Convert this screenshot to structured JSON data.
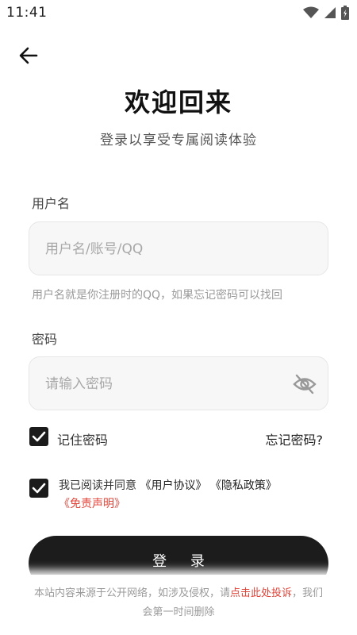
{
  "status_bar": {
    "time": "11:41"
  },
  "header": {
    "title": "欢迎回来",
    "subtitle": "登录以享受专属阅读体验"
  },
  "username": {
    "label": "用户名",
    "placeholder": "用户名/账号/QQ",
    "value": "",
    "hint": "用户名就是你注册时的QQ，如果忘记密码可以找回"
  },
  "password": {
    "label": "密码",
    "placeholder": "请输入密码",
    "value": ""
  },
  "remember": {
    "label": "记住密码",
    "checked": true
  },
  "forgot_link": "忘记密码?",
  "agreement": {
    "checked": true,
    "prefix": "我已阅读并同意 ",
    "user_agreement": "《用户协议》",
    "privacy_policy": " 《隐私政策》",
    "disclaimer": "《免责声明》"
  },
  "login_button": "登 录",
  "footer": {
    "text_before": "本站内容来源于公开网络，如涉及侵权，请",
    "complain_link": "点击此处投诉",
    "text_after": "，我们会第一时间删除"
  },
  "colors": {
    "accent": "#1c1c1c",
    "link_red": "#e0453a"
  }
}
